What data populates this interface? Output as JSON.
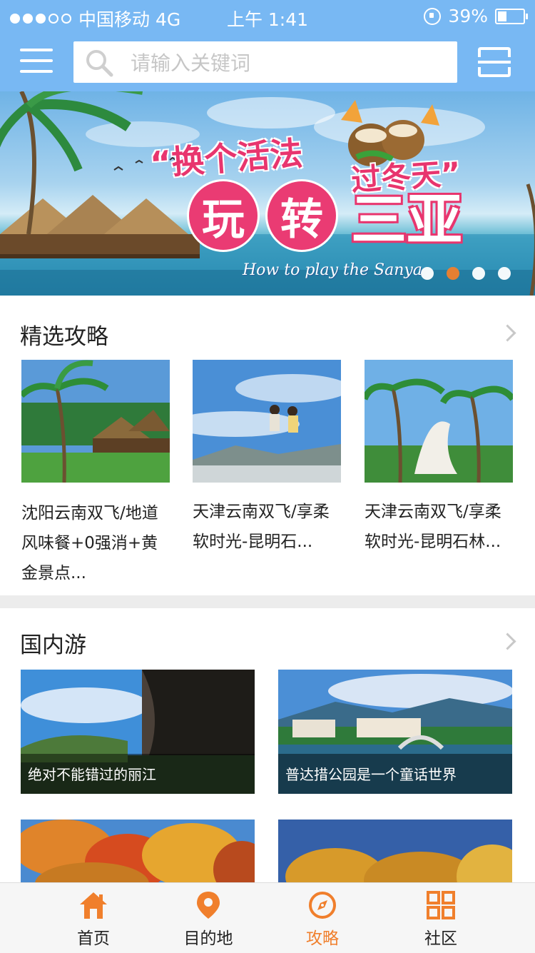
{
  "status_bar": {
    "carrier": "中国移动 4G",
    "time": "上午 1:41",
    "battery": "39%",
    "battery_level": 0.39
  },
  "search": {
    "placeholder": "请输入关键词"
  },
  "banner": {
    "headline_1": "“换个活法",
    "headline_2": "过冬天”",
    "play_1": "玩",
    "play_2": "转",
    "play_3": "三亚",
    "tagline": "How to play the Sanya",
    "active_slide": 2,
    "slide_count": 4
  },
  "featured": {
    "title": "精选攻略",
    "items": [
      {
        "title": "沈阳云南双飞/地道风味餐+0强消+黄金景点..."
      },
      {
        "title": "天津云南双飞/享柔软时光-昆明石..."
      },
      {
        "title": "天津云南双飞/享柔软时光-昆明石林..."
      }
    ]
  },
  "domestic": {
    "title": "国内游",
    "items": [
      {
        "caption": "绝对不能错过的丽江"
      },
      {
        "caption": "普达措公园是一个童话世界"
      },
      {
        "caption": ""
      },
      {
        "caption": ""
      }
    ]
  },
  "tabs": [
    {
      "label": "首页",
      "icon": "home-icon"
    },
    {
      "label": "目的地",
      "icon": "location-pin-icon"
    },
    {
      "label": "攻略",
      "icon": "compass-icon",
      "active": true
    },
    {
      "label": "社区",
      "icon": "grid-icon"
    }
  ],
  "colors": {
    "header": "#78b8f3",
    "accent": "#f07f2c",
    "banner_pink": "#e8356e"
  }
}
